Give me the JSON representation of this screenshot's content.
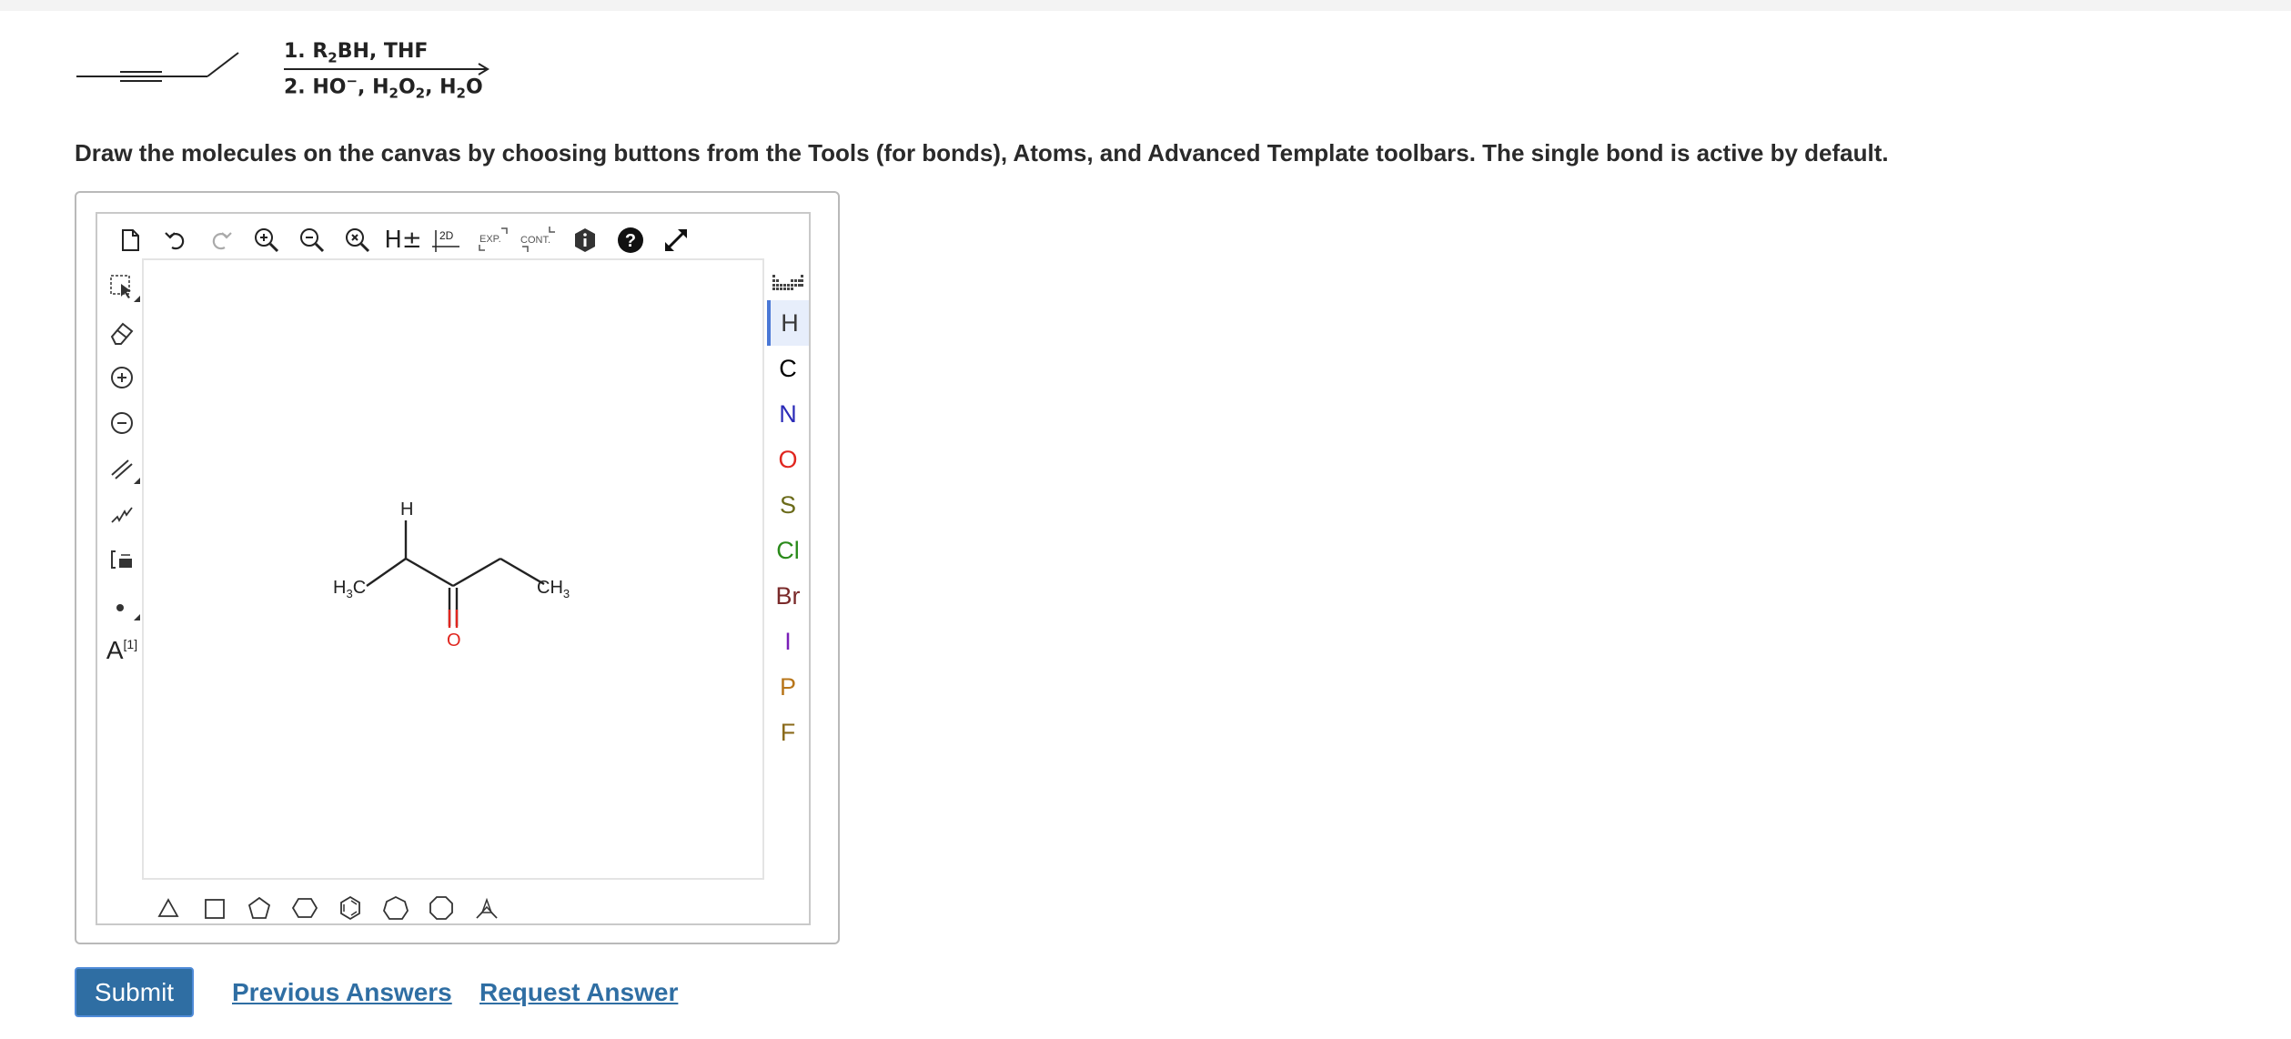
{
  "reaction": {
    "condition_1": {
      "step": "1.",
      "reagent": "R",
      "sub": "2",
      "rest": "BH, THF"
    },
    "condition_2": {
      "step": "2.",
      "hydroxide": "HO",
      "charge": "−",
      "sep": ",",
      "peroxide": "H",
      "peroxide_sub1": "2",
      "peroxide_o": "O",
      "peroxide_sub2": "2",
      "water": "H",
      "water_sub": "2",
      "water_o": "O"
    }
  },
  "instructions": "Draw the molecules on the canvas by choosing buttons from the Tools (for bonds), Atoms, and Advanced Template toolbars. The single bond is active by default.",
  "top_toolbar": {
    "h_toggle": "H±",
    "clean_2d": "2D",
    "expand": "EXP.",
    "contract": "CONT."
  },
  "left_toolbar": {
    "label_tool": "A",
    "label_index": "[1]"
  },
  "molecule_labels": {
    "h_atom": "H",
    "methyl_left": "H",
    "methyl_left_sub": "3",
    "methyl_left_c": "C",
    "methyl_right_c": "CH",
    "methyl_right_sub": "3",
    "oxygen": "O"
  },
  "atoms": [
    {
      "symbol": "H",
      "color": "#3a3a3a"
    },
    {
      "symbol": "C",
      "color": "#000000"
    },
    {
      "symbol": "N",
      "color": "#2b2bb8"
    },
    {
      "symbol": "O",
      "color": "#e0261f"
    },
    {
      "symbol": "S",
      "color": "#6b6b1a"
    },
    {
      "symbol": "Cl",
      "color": "#2a8a1a"
    },
    {
      "symbol": "Br",
      "color": "#7a2a2a"
    },
    {
      "symbol": "I",
      "color": "#7a1fb8"
    },
    {
      "symbol": "P",
      "color": "#b8761a"
    },
    {
      "symbol": "F",
      "color": "#8a6a1a"
    }
  ],
  "selected_atom": "H",
  "buttons": {
    "submit": "Submit",
    "previous_answers": "Previous Answers",
    "request_answer": "Request Answer"
  },
  "colors": {
    "accent": "#2f6ea3",
    "selection": "#4a78d6",
    "oxygen": "#e0261f"
  }
}
